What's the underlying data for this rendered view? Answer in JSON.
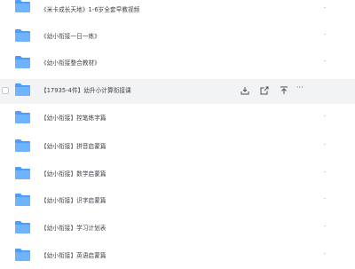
{
  "files": [
    {
      "name": "《米卡成长天地》1-6岁全套早教视频",
      "modified": "-"
    },
    {
      "name": "《幼小衔接一日一练》",
      "modified": "-"
    },
    {
      "name": "《幼小衔接整合教材》",
      "modified": "-"
    },
    {
      "name": "【17935-4件】幼升小计算衔接课",
      "modified": "-",
      "hovered": true
    },
    {
      "name": "【幼小衔接】控笔练字篇",
      "modified": "-"
    },
    {
      "name": "【幼小衔接】拼音启蒙篇",
      "modified": "-"
    },
    {
      "name": "【幼小衔接】数学启蒙篇",
      "modified": "-"
    },
    {
      "name": "【幼小衔接】识字启蒙篇",
      "modified": "-"
    },
    {
      "name": "【幼小衔接】学习计划表",
      "modified": "-"
    },
    {
      "name": "【幼小衔接】英语启蒙篇",
      "modified": "-"
    }
  ],
  "row_actions": {
    "download_icon": "download-icon",
    "share_icon": "share-icon",
    "pin_icon": "pin-to-top-icon",
    "more_label": "···"
  },
  "colors": {
    "folder": "#4a9eff",
    "folder_light": "#8ac4ff",
    "hover_bg": "#f2f3f5"
  }
}
